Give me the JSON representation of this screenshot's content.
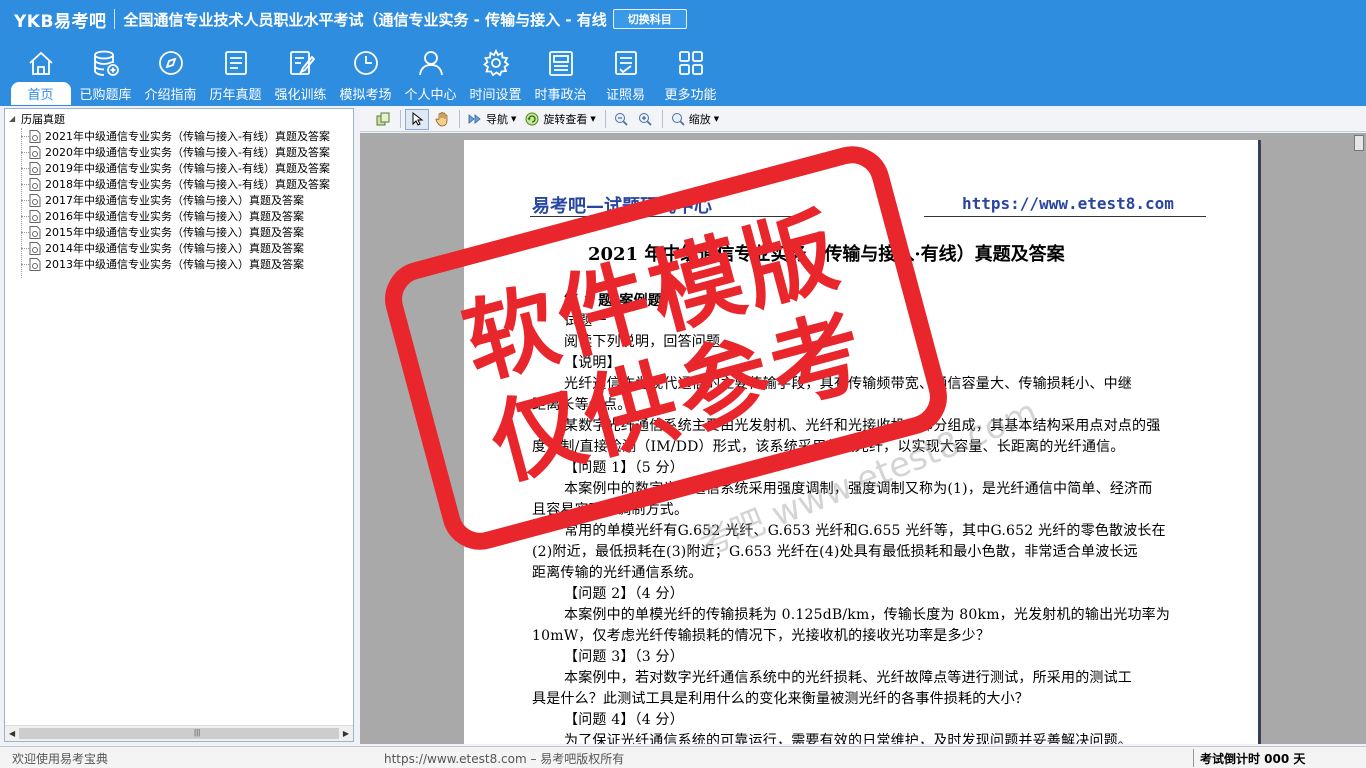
{
  "header": {
    "logo": "YKB易考吧",
    "title": "全国通信专业技术人员职业水平考试（通信专业实务 - 传输与接入 - 有线",
    "switch_label": "切换科目"
  },
  "nav": {
    "items": [
      {
        "label": "首页",
        "icon": "home-icon"
      },
      {
        "label": "已购题库",
        "icon": "database-add-icon"
      },
      {
        "label": "介绍指南",
        "icon": "compass-icon"
      },
      {
        "label": "历年真题",
        "icon": "list-doc-icon"
      },
      {
        "label": "强化训练",
        "icon": "edit-doc-icon"
      },
      {
        "label": "模拟考场",
        "icon": "clock-icon"
      },
      {
        "label": "个人中心",
        "icon": "user-icon"
      },
      {
        "label": "时间设置",
        "icon": "gear-icon"
      },
      {
        "label": "时事政治",
        "icon": "news-icon"
      },
      {
        "label": "证照易",
        "icon": "certificate-icon"
      },
      {
        "label": "更多功能",
        "icon": "grid-icon"
      }
    ]
  },
  "tree": {
    "root": "历届真题",
    "items": [
      "2021年中级通信专业实务（传输与接入-有线）真题及答案",
      "2020年中级通信专业实务（传输与接入-有线）真题及答案",
      "2019年中级通信专业实务（传输与接入-有线）真题及答案",
      "2018年中级通信专业实务（传输与接入-有线）真题及答案",
      "2017年中级通信专业实务（传输与接入）真题及答案",
      "2016年中级通信专业实务（传输与接入）真题及答案",
      "2015年中级通信专业实务（传输与接入）真题及答案",
      "2014年中级通信专业实务（传输与接入）真题及答案",
      "2013年中级通信专业实务（传输与接入）真题及答案"
    ]
  },
  "toolbar": {
    "nav_label": "导航",
    "rotate_label": "旋转查看",
    "zoom_label": "缩放"
  },
  "document": {
    "header_left": "易考吧—试题研究中心",
    "header_right": "https://www.etest8.com",
    "title": "2021 年中级通信专业实务（传输与接入·有线）真题及答案",
    "lines": [
      "第 1 题(案例题):",
      "试题一",
      "阅读下列说明，回答问题。",
      "【说明】",
      "光纤通信作为现代通信的主要传输手段，具有传输频带宽、通信容量大、传输损耗小、中继",
      "距离长等优点。",
      "某数字光纤通信系统主要由光发射机、光纤和光接收机三部分组成，其基本结构采用点对点的强",
      "度调制/直接检测（IM/DD）形式，该系统采用单模光纤，以实现大容量、长距离的光纤通信。",
      "【问题 1】（5 分）",
      "本案例中的数字光纤通信系统采用强度调制，强度调制又称为(1)，是光纤通信中简单、经济而",
      "且容易实现的调制方式。",
      "常用的单模光纤有G.652 光纤、G.653 光纤和G.655 光纤等，其中G.652 光纤的零色散波长在",
      "(2)附近，最低损耗在(3)附近；G.653 光纤在(4)处具有最低损耗和最小色散，非常适合单波长远",
      "距离传输的光纤通信系统。",
      "【问题 2】（4 分）",
      "本案例中的单模光纤的传输损耗为 0.125dB/km，传输长度为 80km，光发射机的输出光功率为",
      "10mW，仅考虑光纤传输损耗的情况下，光接收机的接收光功率是多少？",
      "【问题 3】（3 分）",
      "本案例中，若对数字光纤通信系统中的光纤损耗、光纤故障点等进行测试，所采用的测试工",
      "具是什么？此测试工具是利用什么的变化来衡量被测光纤的各事件损耗的大小？",
      "【问题 4】（4 分）",
      "为了保证光纤通信系统的可靠运行，需要有效的日常维护，及时发现问题并妥善解决问题。"
    ]
  },
  "watermark": {
    "stamp_line_1": "软件模版",
    "stamp_line_2": "仅供参考",
    "url": "考吧 www.etest8.com",
    "stamp_color": "#e8262b"
  },
  "status": {
    "left": "欢迎使用易考宝典",
    "center": "https://www.etest8.com – 易考吧版权所有",
    "right": "考试倒计时 000 天"
  },
  "colors": {
    "header_bg": "#2f8de0",
    "doc_header": "#2846a0"
  }
}
